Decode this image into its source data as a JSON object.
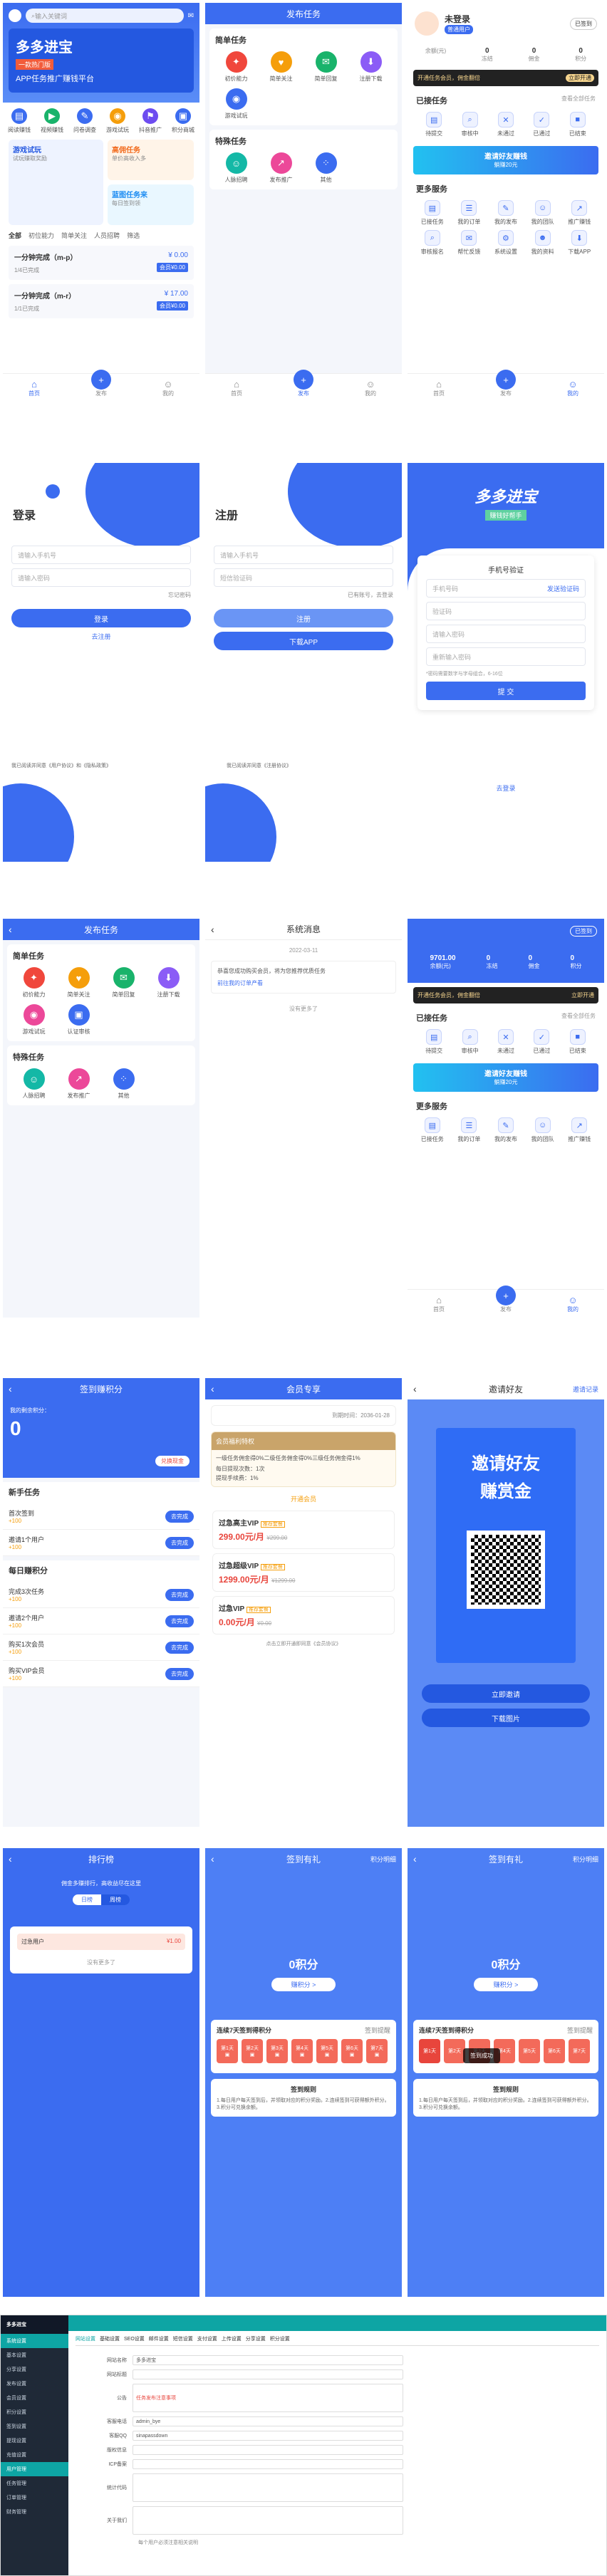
{
  "home": {
    "search": "输入关键词",
    "banner_title": "多多进宝",
    "banner_sub": "一款热门版",
    "banner_sub2": "APP任务推广赚钱平台",
    "cats": [
      "阅读赚钱",
      "视频赚钱",
      "问卷调查",
      "游戏试玩",
      "抖音推广",
      "积分商城"
    ],
    "promo1": {
      "t": "游戏试玩",
      "s": "试玩赚取奖励"
    },
    "promo2": {
      "t": "高佣任务",
      "s": "单价高收入多"
    },
    "promo3": {
      "t": "蓝图任务来",
      "s": "每日签到领"
    },
    "filters": [
      "全部",
      "初位能力",
      "简单关注",
      "人员招聘",
      "筛选"
    ],
    "tasks": [
      {
        "title": "一分钟完成（m-p）",
        "price": "¥ 0.00",
        "meta": "1/4已完成",
        "tag": "会员¥0.00"
      },
      {
        "title": "一分钟完成（m-r）",
        "price": "¥ 17.00",
        "meta": "1/1已完成",
        "tag": "会员¥0.00"
      }
    ],
    "tabs": [
      "首页",
      "发布",
      "我的"
    ]
  },
  "publish": {
    "title": "发布任务",
    "simple": "简单任务",
    "simple_items": [
      "初价能力",
      "简单关注",
      "简单回复",
      "注册下载",
      "游戏试玩",
      "认证审核"
    ],
    "special": "特殊任务",
    "special_items": [
      "人脉招聘",
      "发布推广",
      "其他"
    ]
  },
  "mine": {
    "user": "未登录",
    "badge": "普通用户",
    "checkin": "已签到",
    "stats": [
      {
        "v": "",
        "l": "余额(元)"
      },
      {
        "v": "0",
        "l": "冻结"
      },
      {
        "v": "0",
        "l": "佣金"
      },
      {
        "v": "0",
        "l": "积分"
      }
    ],
    "vip_tip": "开通任务会员，佣金翻倍",
    "vip_btn": "立即开通",
    "pub_title": "已接任务",
    "pub_all": "查看全部任务",
    "pub_items": [
      "待提交",
      "审核中",
      "未通过",
      "已通过",
      "已结束"
    ],
    "invite": "邀请好友赚钱",
    "invite_sub": "躺赚20元",
    "more": "更多服务",
    "more_items": [
      "已接任务",
      "我的订单",
      "我的发布",
      "我的团队",
      "推广赚钱",
      "审核报名",
      "帮忙反馈",
      "系统设置",
      "我的资料",
      "下载APP"
    ],
    "tabs": [
      "首页",
      "发布",
      "我的"
    ]
  },
  "login": {
    "title": "登录",
    "phone_ph": "请输入手机号",
    "pwd_ph": "请输入密码",
    "forgot": "忘记密码",
    "login_btn": "登录",
    "register": "去注册",
    "agree": "我已阅读并同意《用户协议》和《隐私政策》"
  },
  "register": {
    "title": "注册",
    "phone_ph": "请输入手机号",
    "sms": "短信验证码",
    "have": "已有账号，去登录",
    "btn": "注册",
    "download": "下载APP",
    "agree": "我已阅读并同意《注册协议》"
  },
  "verify": {
    "logo": "多多进宝",
    "logo_sub": "赚钱好帮手",
    "card_title": "手机号验证",
    "phone_ph": "手机号码",
    "send": "发送验证码",
    "code_ph": "验证码",
    "pwd_ph": "请输入密码",
    "pwd2_ph": "重新输入密码",
    "hint": "*密码需要数字与字母组合，6-16位",
    "btn": "提 交",
    "back": "去登录"
  },
  "messages": {
    "title": "系统消息",
    "date": "2022-03-11",
    "msg": "恭喜您成功购买会员，将为您推荐优质任务",
    "link": "前往我的订单产看",
    "none": "没有更多了"
  },
  "mine2": {
    "stats": [
      {
        "v": "9701.00",
        "l": "余额(元)"
      },
      {
        "v": "0",
        "l": "冻结"
      },
      {
        "v": "0",
        "l": "佣金"
      },
      {
        "v": "0",
        "l": "积分"
      }
    ]
  },
  "signin": {
    "title": "签到赚积分",
    "points_label": "我的剩余积分：",
    "points": "0",
    "gift": "兑换现金",
    "newbie": "新手任务",
    "newbie_items": [
      {
        "t": "首次签到",
        "r": "+100"
      },
      {
        "t": "邀请1个用户",
        "r": "+100"
      }
    ],
    "daily": "每日赚积分",
    "daily_items": [
      {
        "t": "完成3次任务",
        "r": "+100"
      },
      {
        "t": "邀请2个用户",
        "r": "+100"
      },
      {
        "t": "购买1次会员",
        "r": "+100"
      },
      {
        "t": "购买VIP会员",
        "r": "+100"
      }
    ],
    "go": "去完成"
  },
  "vipcenter": {
    "title": "会员专享",
    "expire": "到期时间：2036-01-28",
    "card": "会员福利特权",
    "desc": "一级任务佣金得0%二级任务佣金得0%三级任务佣金得1%",
    "d1": "每日提现次数：1次",
    "d2": "提现手续费：1%",
    "open": "开通会员",
    "plans": [
      {
        "n": "过急高主VIP",
        "p": "299.00元/月",
        "o": "¥299.00",
        "tag": "推荐套餐"
      },
      {
        "n": "过急超级VIP",
        "p": "1299.00元/月",
        "o": "¥1299.00",
        "tag": "推荐套餐"
      },
      {
        "n": "过急VIP",
        "p": "0.00元/月",
        "o": "¥0.00",
        "tag": "推荐套餐"
      }
    ],
    "agree": "点击立即开通即同意《会员协议》"
  },
  "invitef": {
    "title": "邀请好友",
    "right": "邀请记录",
    "poster": "邀请好友",
    "poster2": "赚赏金",
    "btn1": "立即邀请",
    "btn2": "下载图片"
  },
  "rank": {
    "title": "排行榜",
    "tip": "佣金多赚排行，高收益尽在这里",
    "tabs": [
      "日榜",
      "周榜"
    ],
    "name": "过急用户",
    "amount": "¥1.00",
    "none": "没有更多了"
  },
  "gift": {
    "title": "签到有礼",
    "right": "积分明细",
    "points": "0积分",
    "earn": "赚积分 >",
    "head": "连续7天签到得积分",
    "remind": "签到提醒",
    "days": [
      "第1天",
      "第2天",
      "第3天",
      "第4天",
      "第5天",
      "第6天",
      "第7天"
    ],
    "rule": "签到规则",
    "rule_text": "1.每日用户每天签到后，并领取对应的积分奖励。2.连续签到可获得额外积分。3.积分可兑换余额。",
    "toast": "签到成功"
  },
  "admin": {
    "title": "多多进宝",
    "menu": [
      "系统设置",
      "基本设置",
      "分享设置",
      "发布设置",
      "会员设置",
      "积分设置",
      "签到设置",
      "提现设置",
      "充值设置",
      "用户管理",
      "任务管理",
      "订单管理",
      "财务管理"
    ],
    "tabs": [
      "网站设置",
      "基础设置",
      "SEO设置",
      "邮件设置",
      "短信设置",
      "支付设置",
      "上传设置",
      "分享设置",
      "积分设置"
    ],
    "fields": [
      {
        "l": "网站名称",
        "v": "多多进宝"
      },
      {
        "l": "网站标题",
        "v": ""
      },
      {
        "l": "公告",
        "v": "任务发布注意事项"
      },
      {
        "l": "客服电话",
        "v": "admin_bye"
      },
      {
        "l": "客服QQ",
        "v": "sinapassdown"
      },
      {
        "l": "版权信息",
        "v": ""
      },
      {
        "l": "ICP备案",
        "v": ""
      },
      {
        "l": "统计代码",
        "v": ""
      },
      {
        "l": "关于我们",
        "v": ""
      }
    ],
    "note": "每个用户必须注意相关说明"
  }
}
